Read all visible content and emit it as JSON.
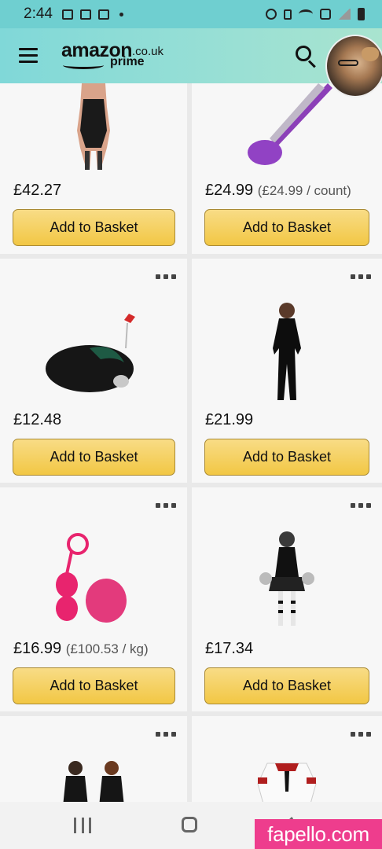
{
  "status_bar": {
    "time": "2:44",
    "icons": [
      "gallery-icon",
      "browser-icon",
      "keyboard-icon",
      "dot-icon",
      "alarm-icon",
      "battery-saver-icon",
      "wifi-icon",
      "call-icon",
      "signal-icon",
      "battery-icon"
    ]
  },
  "header": {
    "logo_main": "amazon",
    "logo_tld": ".co.uk",
    "logo_sub": "prime",
    "menu_icon": "hamburger-menu-icon",
    "search_icon": "search-icon"
  },
  "products": [
    {
      "price": "£42.27",
      "unit_price": "",
      "button_label": "Add to Basket",
      "image": "lingerie-bodysuit-image"
    },
    {
      "price": "£24.99",
      "unit_price": "(£24.99 / count)",
      "button_label": "Add to Basket",
      "image": "purple-wand-image"
    },
    {
      "price": "£12.48",
      "unit_price": "",
      "button_label": "Add to Basket",
      "image": "black-fur-tail-image"
    },
    {
      "price": "£21.99",
      "unit_price": "",
      "button_label": "Add to Basket",
      "image": "black-catsuit-image"
    },
    {
      "price": "£16.99",
      "unit_price": "(£100.53 / kg)",
      "button_label": "Add to Basket",
      "image": "pink-balls-image"
    },
    {
      "price": "£17.34",
      "unit_price": "",
      "button_label": "Add to Basket",
      "image": "cheerleader-costume-image"
    },
    {
      "price": "",
      "unit_price": "",
      "button_label": "",
      "image": "two-women-costume-image"
    },
    {
      "price": "",
      "unit_price": "",
      "button_label": "",
      "image": "maid-costume-image"
    }
  ],
  "nav_bar": {
    "icons": [
      "recent-apps-icon",
      "home-icon",
      "back-icon"
    ]
  },
  "watermark": "fapello.com",
  "colors": {
    "header_teal": "#80d8d8",
    "button_yellow": "#f2c744",
    "watermark_pink": "#ee3d8d"
  }
}
